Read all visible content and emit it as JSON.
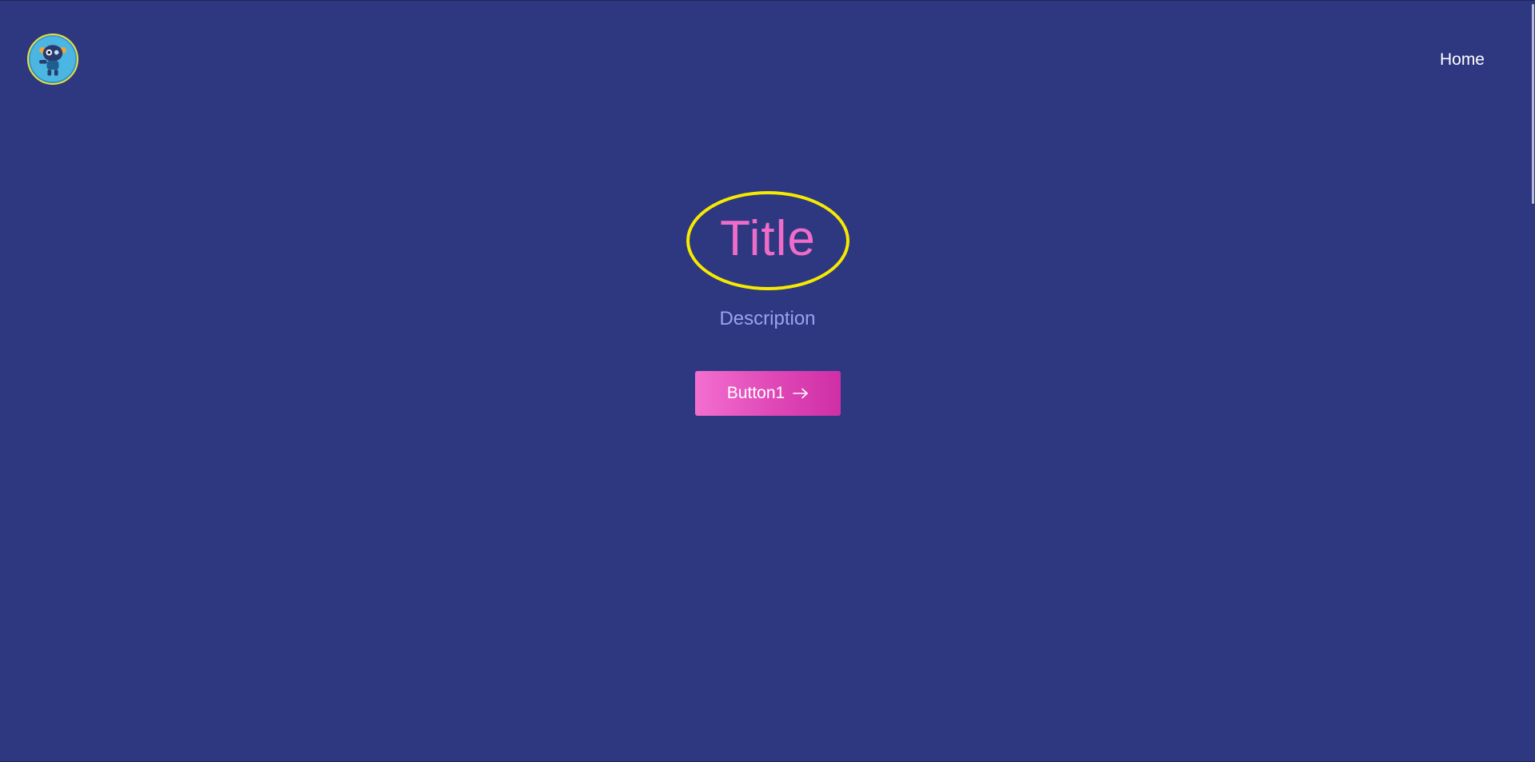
{
  "header": {
    "logo": {
      "icon": "robot-mascot-icon",
      "ring_color": "#e8e23a"
    },
    "nav": {
      "home_label": "Home"
    }
  },
  "hero": {
    "title": "Title",
    "description": "Description",
    "button_label": "Button1",
    "button_icon": "arrow-right-icon",
    "title_highlight_color": "#f5ea00"
  },
  "colors": {
    "background": "#2e3880",
    "title": "#f06cc9",
    "description": "#9aa3ee",
    "button_gradient": [
      "#f36fd0",
      "#cf2fa6"
    ]
  }
}
